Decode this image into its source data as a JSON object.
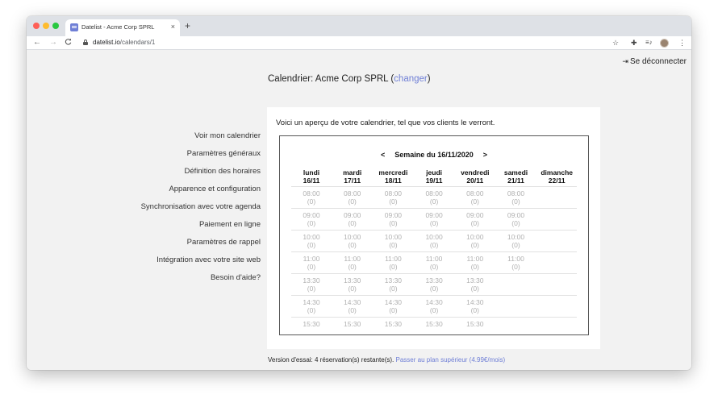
{
  "browser": {
    "tab_title": "Datelist - Acme Corp SPRL",
    "tab_close": "×",
    "new_tab": "+",
    "url_domain": "datelist.io",
    "url_path": "/calendars/1",
    "icons": {
      "back": "arrow-left-icon",
      "forward": "arrow-right-icon",
      "reload": "reload-icon",
      "lock": "lock-icon",
      "star": "star-icon",
      "extensions": "puzzle-icon",
      "media": "media-queue-icon",
      "avatar": "avatar",
      "menu": "kebab-menu-icon"
    },
    "glyphs": {
      "back": "←",
      "forward": "→",
      "reload": "C",
      "star": "☆",
      "extensions": "✚",
      "media": "≡♪",
      "menu": "⋮"
    }
  },
  "header": {
    "logout_icon": "⇥",
    "logout_label": "Se déconnecter"
  },
  "page": {
    "title_prefix": "Calendrier: Acme Corp SPRL (",
    "title_link": "changer",
    "title_suffix": ")"
  },
  "sidebar": {
    "items": [
      {
        "label": "Voir mon calendrier"
      },
      {
        "label": "Paramètres généraux"
      },
      {
        "label": "Définition des horaires"
      },
      {
        "label": "Apparence et configuration"
      },
      {
        "label": "Synchronisation avec votre agenda"
      },
      {
        "label": "Paiement en ligne"
      },
      {
        "label": "Paramètres de rappel"
      },
      {
        "label": "Intégration avec votre site web"
      },
      {
        "label": "Besoin d'aide?"
      }
    ]
  },
  "preview": {
    "intro": "Voici un aperçu de votre calendrier, tel que vos clients le verront.",
    "prev_week": "<",
    "week_label": "Semaine du 16/11/2020",
    "next_week": ">",
    "days": [
      {
        "name": "lundi",
        "date": "16/11",
        "slots": [
          [
            "08:00",
            "(0)"
          ],
          [
            "09:00",
            "(0)"
          ],
          [
            "10:00",
            "(0)"
          ],
          [
            "11:00",
            "(0)"
          ],
          [
            "13:30",
            "(0)"
          ],
          [
            "14:30",
            "(0)"
          ],
          [
            "15:30",
            ""
          ]
        ]
      },
      {
        "name": "mardi",
        "date": "17/11",
        "slots": [
          [
            "08:00",
            "(0)"
          ],
          [
            "09:00",
            "(0)"
          ],
          [
            "10:00",
            "(0)"
          ],
          [
            "11:00",
            "(0)"
          ],
          [
            "13:30",
            "(0)"
          ],
          [
            "14:30",
            "(0)"
          ],
          [
            "15:30",
            ""
          ]
        ]
      },
      {
        "name": "mercredi",
        "date": "18/11",
        "slots": [
          [
            "08:00",
            "(0)"
          ],
          [
            "09:00",
            "(0)"
          ],
          [
            "10:00",
            "(0)"
          ],
          [
            "11:00",
            "(0)"
          ],
          [
            "13:30",
            "(0)"
          ],
          [
            "14:30",
            "(0)"
          ],
          [
            "15:30",
            ""
          ]
        ]
      },
      {
        "name": "jeudi",
        "date": "19/11",
        "slots": [
          [
            "08:00",
            "(0)"
          ],
          [
            "09:00",
            "(0)"
          ],
          [
            "10:00",
            "(0)"
          ],
          [
            "11:00",
            "(0)"
          ],
          [
            "13:30",
            "(0)"
          ],
          [
            "14:30",
            "(0)"
          ],
          [
            "15:30",
            ""
          ]
        ]
      },
      {
        "name": "vendredi",
        "date": "20/11",
        "slots": [
          [
            "08:00",
            "(0)"
          ],
          [
            "09:00",
            "(0)"
          ],
          [
            "10:00",
            "(0)"
          ],
          [
            "11:00",
            "(0)"
          ],
          [
            "13:30",
            "(0)"
          ],
          [
            "14:30",
            "(0)"
          ],
          [
            "15:30",
            ""
          ]
        ]
      },
      {
        "name": "samedi",
        "date": "21/11",
        "slots": [
          [
            "08:00",
            "(0)"
          ],
          [
            "09:00",
            "(0)"
          ],
          [
            "10:00",
            "(0)"
          ],
          [
            "11:00",
            "(0)"
          ]
        ]
      },
      {
        "name": "dimanche",
        "date": "22/11",
        "slots": []
      }
    ]
  },
  "footer": {
    "trial_text": "Version d'essai: 4 réservation(s) restante(s).",
    "upgrade_link": "Passer au plan supérieur (4.99€/mois)"
  },
  "colors": {
    "link": "#6f7fd6",
    "background": "#f2f2f2",
    "slot_text": "#b0b0b0"
  }
}
